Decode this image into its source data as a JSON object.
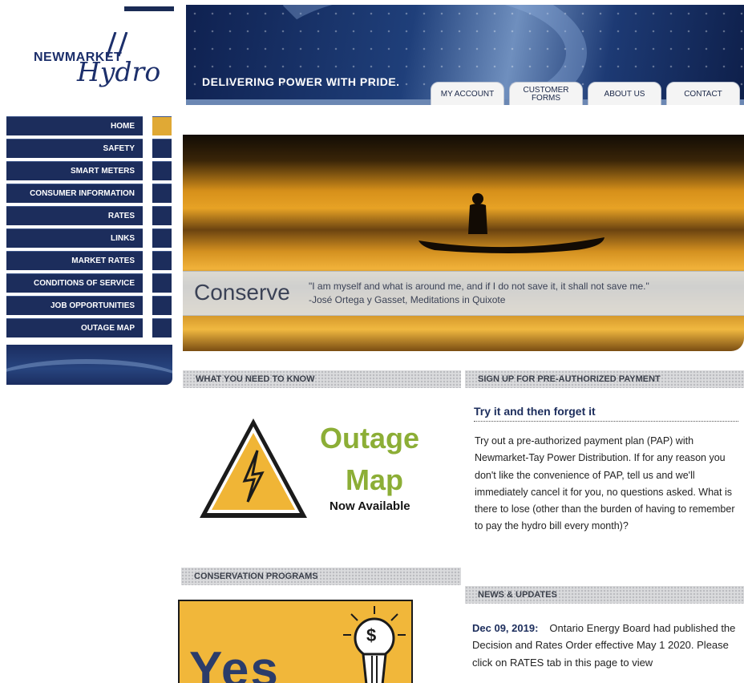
{
  "brand": {
    "name_line1": "NEWMARKET",
    "name_line2": "Hydro"
  },
  "header": {
    "tagline": "DELIVERING POWER WITH PRIDE.",
    "tabs": [
      {
        "label": "MY ACCOUNT"
      },
      {
        "label": "CUSTOMER\nFORMS"
      },
      {
        "label": "ABOUT US"
      },
      {
        "label": "CONTACT"
      }
    ]
  },
  "sidebar": {
    "items": [
      {
        "label": "HOME",
        "active": true
      },
      {
        "label": "SAFETY"
      },
      {
        "label": "SMART METERS"
      },
      {
        "label": "CONSUMER INFORMATION"
      },
      {
        "label": "RATES"
      },
      {
        "label": "LINKS"
      },
      {
        "label": "MARKET RATES"
      },
      {
        "label": "CONDITIONS OF SERVICE"
      },
      {
        "label": "JOB OPPORTUNITIES"
      },
      {
        "label": "OUTAGE MAP"
      }
    ]
  },
  "hero": {
    "caption_word": "Conserve",
    "quote_line1": "\"I am myself and what is around me, and if I do not save it, it shall not save me.\"",
    "quote_line2": "-José Ortega y Gasset, Meditations in Quixote"
  },
  "sections": {
    "need_to_know": "WHAT YOU NEED TO KNOW",
    "pap": "SIGN UP FOR PRE-AUTHORIZED PAYMENT",
    "conservation": "CONSERVATION PROGRAMS",
    "news": "NEWS & UPDATES"
  },
  "outage_promo": {
    "title_line1": "Outage",
    "title_line2": "Map",
    "subtitle": "Now Available"
  },
  "pap": {
    "title": "Try it and then forget it",
    "body": "Try out a pre-authorized payment plan (PAP) with Newmarket-Tay Power Distribution. If for any reason you don't like the convenience of PAP, tell us and we'll immediately cancel it for you, no questions asked. What is there to lose (other than the burden of having to remember to pay the hydro bill every month)?"
  },
  "news": {
    "date": "Dec 09, 2019:",
    "text": "Ontario Energy Board had published the Decision and Rates Order effective May 1 2020. Please click on RATES tab in this page to view"
  },
  "conservation_card": {
    "big_text": "Yes",
    "bulb_symbol": "$"
  },
  "colors": {
    "navy": "#1c2d5c",
    "accent_gold": "#e0a935",
    "outage_green": "#8cae36",
    "card_yellow": "#f1b73a"
  },
  "icons": [
    "warning-triangle-icon",
    "lightning-bolt-icon",
    "light-bulb-icon"
  ]
}
